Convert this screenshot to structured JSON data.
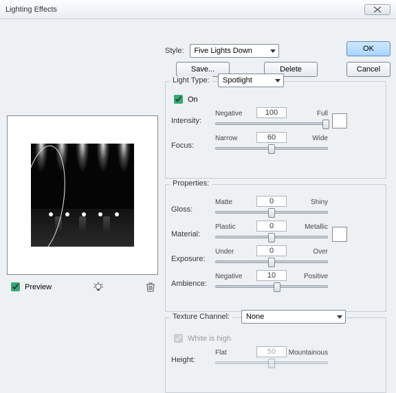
{
  "window": {
    "title": "Lighting Effects"
  },
  "buttons": {
    "ok": "OK",
    "cancel": "Cancel",
    "save": "Save...",
    "delete": "Delete"
  },
  "style": {
    "label": "Style:",
    "value": "Five Lights Down"
  },
  "lightType": {
    "legend": "Light Type:",
    "value": "Spotlight",
    "onLabel": "On",
    "onChecked": true,
    "intensity": {
      "label": "Intensity:",
      "left": "Negative",
      "right": "Full",
      "value": "100",
      "pct": 98
    },
    "focus": {
      "label": "Focus:",
      "left": "Narrow",
      "right": "Wide",
      "value": "60",
      "pct": 50
    }
  },
  "properties": {
    "legend": "Properties:",
    "gloss": {
      "label": "Gloss:",
      "left": "Matte",
      "right": "Shiny",
      "value": "0",
      "pct": 50
    },
    "material": {
      "label": "Material:",
      "left": "Plastic",
      "right": "Metallic",
      "value": "0",
      "pct": 50
    },
    "exposure": {
      "label": "Exposure:",
      "left": "Under",
      "right": "Over",
      "value": "0",
      "pct": 50
    },
    "ambience": {
      "label": "Ambience:",
      "left": "Negative",
      "right": "Positive",
      "value": "10",
      "pct": 55
    }
  },
  "texture": {
    "legend": "Texture Channel:",
    "value": "None",
    "whiteHigh": "White is high",
    "whiteHighChecked": true,
    "height": {
      "label": "Height:",
      "left": "Flat",
      "right": "Mountainous",
      "value": "50",
      "pct": 50
    }
  },
  "preview": {
    "label": "Preview",
    "checked": true
  }
}
